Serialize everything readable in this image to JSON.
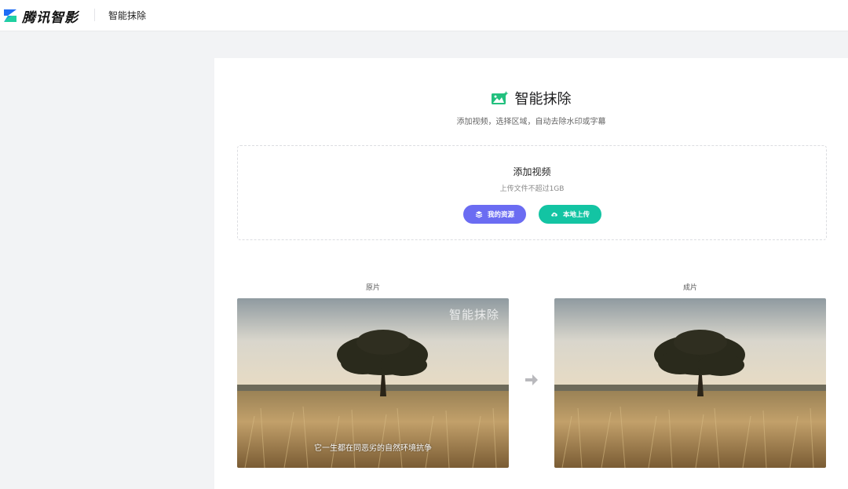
{
  "header": {
    "logo_text": "腾讯智影",
    "nav_title": "智能抹除"
  },
  "main": {
    "title": "智能抹除",
    "subtitle": "添加视频，选择区域，自动去除水印或字幕",
    "upload": {
      "title": "添加视频",
      "hint": "上传文件不超过1GB",
      "resources_button": "我的资源",
      "local_upload_button": "本地上传"
    },
    "comparison": {
      "original_label": "原片",
      "result_label": "成片",
      "watermark_text": "智能抹除",
      "subtitle_text": "它一生都在同恶劣的自然环境抗争"
    }
  },
  "colors": {
    "accent_purple": "#6b6cf2",
    "accent_green": "#13c4a3",
    "logo_blue": "#1e6cf5",
    "logo_green": "#1fd0a0"
  }
}
